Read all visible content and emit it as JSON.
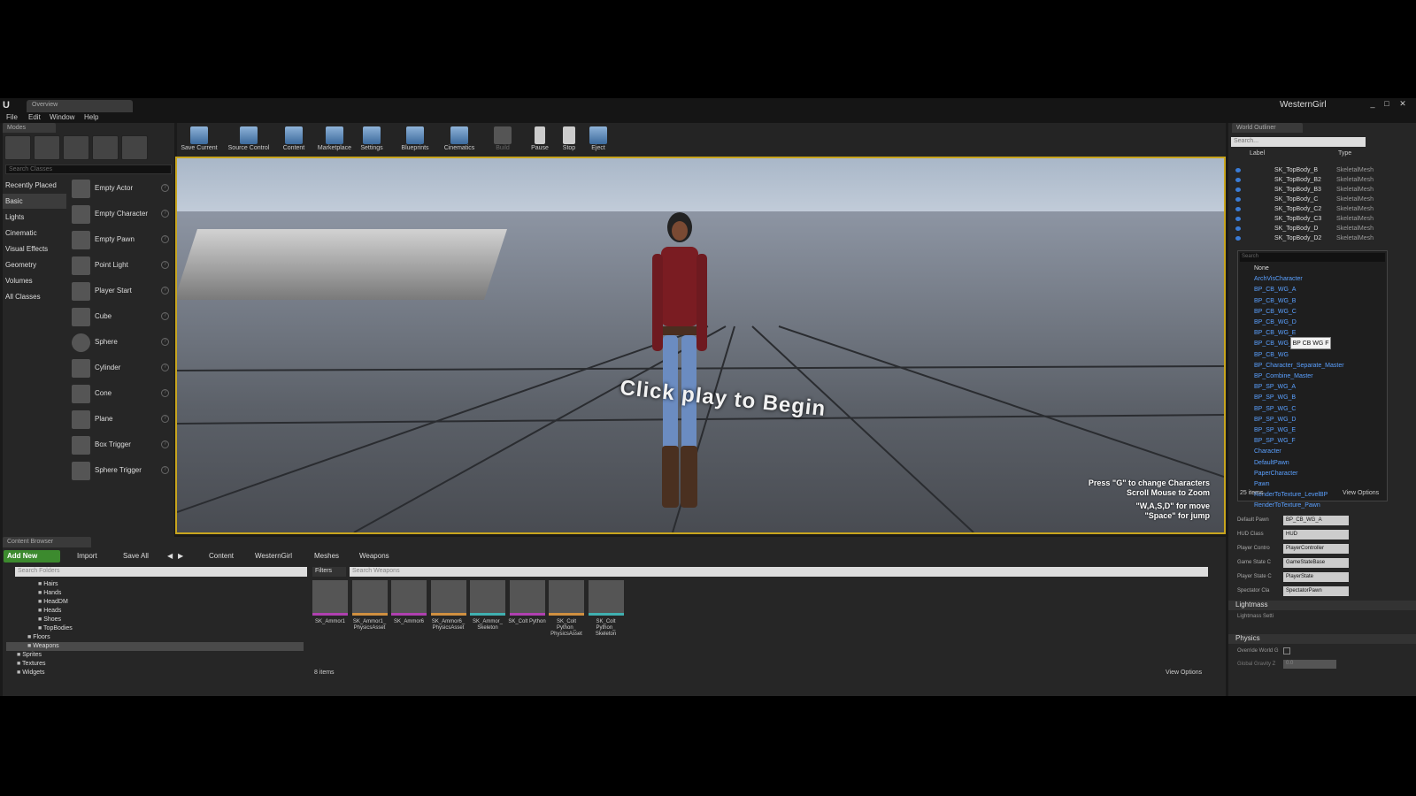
{
  "window": {
    "tab_title": "Overview",
    "project_name": "WesternGirl",
    "controls": [
      "_",
      "□",
      "✕"
    ]
  },
  "menu": [
    "File",
    "Edit",
    "Window",
    "Help"
  ],
  "modes": {
    "tab": "Modes",
    "search_placeholder": "Search Classes",
    "categories": [
      {
        "label": "Recently Placed"
      },
      {
        "label": "Basic",
        "selected": true
      },
      {
        "label": "Lights"
      },
      {
        "label": "Cinematic"
      },
      {
        "label": "Visual Effects"
      },
      {
        "label": "Geometry"
      },
      {
        "label": "Volumes"
      },
      {
        "label": "All Classes"
      }
    ],
    "items": [
      "Empty Actor",
      "Empty Character",
      "Empty Pawn",
      "Point Light",
      "Player Start",
      "Cube",
      "Sphere",
      "Cylinder",
      "Cone",
      "Plane",
      "Box Trigger",
      "Sphere Trigger"
    ]
  },
  "toolbar": [
    {
      "label": "Save Current"
    },
    {
      "label": "Source Control"
    },
    {
      "label": "Content"
    },
    {
      "label": "Marketplace"
    },
    {
      "label": "Settings"
    },
    {
      "label": "Blueprints"
    },
    {
      "label": "Cinematics"
    },
    {
      "label": "Build",
      "disabled": true
    },
    {
      "label": "Pause"
    },
    {
      "label": "Stop"
    },
    {
      "label": "Eject"
    }
  ],
  "viewport": {
    "center_text": "Click play to Begin",
    "hints": [
      "Press \"G\" to change  Characters",
      "Scroll Mouse to Zoom",
      "\"W,A,S,D\" for move",
      "\"Space\" for jump"
    ]
  },
  "outliner": {
    "tab": "World Outliner",
    "search_placeholder": "Search...",
    "col_label": "Label",
    "col_type": "Type",
    "rows": [
      {
        "label": "SK_TopBody_B",
        "type": "SkeletalMesh"
      },
      {
        "label": "SK_TopBody_B2",
        "type": "SkeletalMesh"
      },
      {
        "label": "SK_TopBody_B3",
        "type": "SkeletalMesh"
      },
      {
        "label": "SK_TopBody_C",
        "type": "SkeletalMesh"
      },
      {
        "label": "SK_TopBody_C2",
        "type": "SkeletalMesh"
      },
      {
        "label": "SK_TopBody_C3",
        "type": "SkeletalMesh"
      },
      {
        "label": "SK_TopBody_D",
        "type": "SkeletalMesh"
      },
      {
        "label": "SK_TopBody_D2",
        "type": "SkeletalMesh"
      }
    ],
    "picker": {
      "search_placeholder": "Search",
      "items": [
        "None",
        "ArchVisCharacter",
        "BP_CB_WG_A",
        "BP_CB_WG_B",
        "BP_CB_WG_C",
        "BP_CB_WG_D",
        "BP_CB_WG_E",
        "BP_CB_WG_F",
        "BP_CB_WG",
        "BP_Character_Separate_Master",
        "BP_Combine_Master",
        "BP_SP_WG_A",
        "BP_SP_WG_B",
        "BP_SP_WG_C",
        "BP_SP_WG_D",
        "BP_SP_WG_E",
        "BP_SP_WG_F",
        "Character",
        "DefaultPawn",
        "PaperCharacter",
        "Pawn",
        "RenderToTexture_LevelBP",
        "RenderToTexture_Pawn"
      ],
      "count": "25 items",
      "view_options": "View Options",
      "tooltip": "BP CB WG F"
    },
    "properties": [
      {
        "label": "Default Pawn",
        "value": "BP_CB_WG_A"
      },
      {
        "label": "HUD Class",
        "value": "HUD"
      },
      {
        "label": "Player Contro",
        "value": "PlayerController"
      },
      {
        "label": "Game State C",
        "value": "GameStateBase"
      },
      {
        "label": "Player State C",
        "value": "PlayerState"
      },
      {
        "label": "Spectator Cla",
        "value": "SpectatorPawn"
      }
    ],
    "lightmass_section": "Lightmass",
    "lightmass_row": "Lightmass Setti",
    "physics_section": "Physics",
    "physics_row1": "Override World G",
    "physics_row2": "Global Gravity Z",
    "physics_value": "0.0"
  },
  "content_browser": {
    "tab": "Content Browser",
    "add_new": "Add New",
    "import": "Import",
    "save_all": "Save All",
    "breadcrumb": [
      "Content",
      "WesternGirl",
      "Meshes",
      "Weapons"
    ],
    "folder_search": "Search Folders",
    "asset_search": "Search Weapons",
    "filters": "Filters",
    "folders": [
      {
        "label": "Hairs",
        "indent": 3
      },
      {
        "label": "Hands",
        "indent": 3
      },
      {
        "label": "HeadDM",
        "indent": 3
      },
      {
        "label": "Heads",
        "indent": 3
      },
      {
        "label": "Shoes",
        "indent": 3
      },
      {
        "label": "TopBodies",
        "indent": 3
      },
      {
        "label": "Floors",
        "indent": 2
      },
      {
        "label": "Weapons",
        "indent": 2,
        "selected": true
      },
      {
        "label": "Sprites",
        "indent": 1
      },
      {
        "label": "Textures",
        "indent": 1
      },
      {
        "label": "Widgets",
        "indent": 1
      }
    ],
    "assets": [
      {
        "label": "SK_Ammor1",
        "color": "#b040b0"
      },
      {
        "label": "SK_Ammor1_ PhysicsAsset",
        "color": "#d09040"
      },
      {
        "label": "SK_Ammor6",
        "color": "#b040b0"
      },
      {
        "label": "SK_Ammor6_ PhysicsAsset",
        "color": "#d09040"
      },
      {
        "label": "SK_Ammor_ Skeleton",
        "color": "#40b0b0"
      },
      {
        "label": "SK_Colt Python",
        "color": "#b040b0"
      },
      {
        "label": "SK_Colt Python_ PhysicsAsset",
        "color": "#d09040"
      },
      {
        "label": "SK_Colt Python_ Skeleton",
        "color": "#40b0b0"
      }
    ],
    "count": "8 items",
    "view_options": "View Options"
  }
}
